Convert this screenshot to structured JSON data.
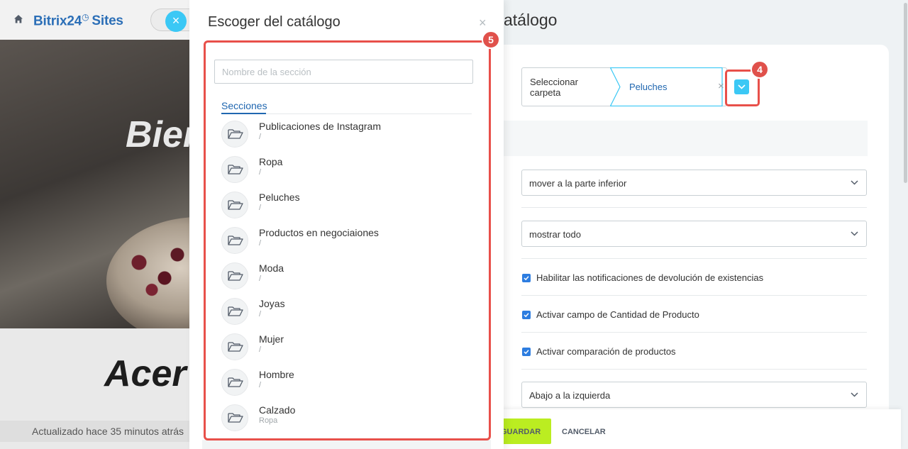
{
  "site": {
    "brand_name": "Bitrix24",
    "brand_suffix": "Sites",
    "hero_text": "Bien",
    "lower_text": "Acer",
    "updated_text": "Actualizado hace 35 minutos atrás",
    "close_symbol": "×"
  },
  "settings": {
    "title_fragment": "atálogo",
    "folder_select": {
      "label": "Seleccionar carpeta",
      "chip": "Peluches",
      "chip_remove": "×"
    },
    "selects": [
      {
        "value": "mover a la parte inferior"
      },
      {
        "value": "mostrar todo"
      },
      {
        "value": "Abajo a la izquierda"
      }
    ],
    "checkboxes": [
      {
        "label": "Habilitar las notificaciones de devolución de existencias",
        "checked": true
      },
      {
        "label": "Activar campo de Cantidad de Producto",
        "checked": true
      },
      {
        "label": "Activar comparación de productos",
        "checked": true
      }
    ],
    "save_label": "GUARDAR",
    "cancel_label": "CANCELAR"
  },
  "picker": {
    "title": "Escoger del catálogo",
    "close_symbol": "×",
    "search_placeholder": "Nombre de la sección",
    "tab_label": "Secciones",
    "sections": [
      {
        "name": "Publicaciones de Instagram",
        "path": "/"
      },
      {
        "name": "Ropa",
        "path": "/"
      },
      {
        "name": "Peluches",
        "path": "/"
      },
      {
        "name": "Productos en negociaiones",
        "path": "/"
      },
      {
        "name": "Moda",
        "path": "/"
      },
      {
        "name": "Joyas",
        "path": "/"
      },
      {
        "name": "Mujer",
        "path": "/"
      },
      {
        "name": "Hombre",
        "path": "/"
      },
      {
        "name": "Calzado",
        "path": "Ropa"
      }
    ]
  },
  "annotations": {
    "step_dropdown": "4",
    "step_list": "5"
  },
  "colors": {
    "accent": "#3bc8f5",
    "link": "#2067b0",
    "highlight": "#e8504a",
    "save": "#bbed21"
  }
}
